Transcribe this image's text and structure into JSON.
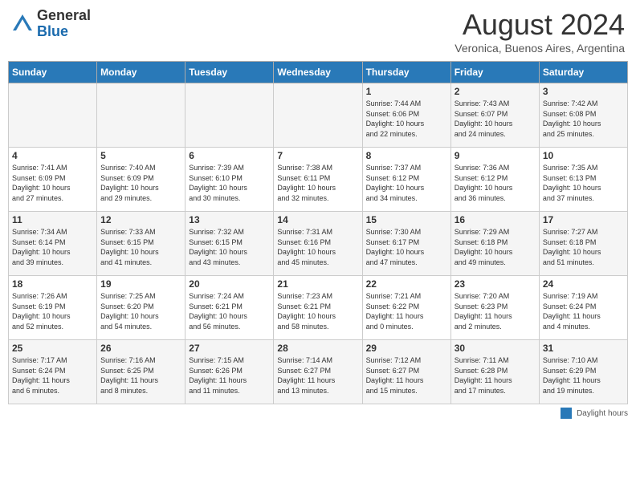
{
  "header": {
    "logo_general": "General",
    "logo_blue": "Blue",
    "month_title": "August 2024",
    "location": "Veronica, Buenos Aires, Argentina"
  },
  "days_of_week": [
    "Sunday",
    "Monday",
    "Tuesday",
    "Wednesday",
    "Thursday",
    "Friday",
    "Saturday"
  ],
  "weeks": [
    [
      {
        "day": "",
        "info": ""
      },
      {
        "day": "",
        "info": ""
      },
      {
        "day": "",
        "info": ""
      },
      {
        "day": "",
        "info": ""
      },
      {
        "day": "1",
        "info": "Sunrise: 7:44 AM\nSunset: 6:06 PM\nDaylight: 10 hours\nand 22 minutes."
      },
      {
        "day": "2",
        "info": "Sunrise: 7:43 AM\nSunset: 6:07 PM\nDaylight: 10 hours\nand 24 minutes."
      },
      {
        "day": "3",
        "info": "Sunrise: 7:42 AM\nSunset: 6:08 PM\nDaylight: 10 hours\nand 25 minutes."
      }
    ],
    [
      {
        "day": "4",
        "info": "Sunrise: 7:41 AM\nSunset: 6:09 PM\nDaylight: 10 hours\nand 27 minutes."
      },
      {
        "day": "5",
        "info": "Sunrise: 7:40 AM\nSunset: 6:09 PM\nDaylight: 10 hours\nand 29 minutes."
      },
      {
        "day": "6",
        "info": "Sunrise: 7:39 AM\nSunset: 6:10 PM\nDaylight: 10 hours\nand 30 minutes."
      },
      {
        "day": "7",
        "info": "Sunrise: 7:38 AM\nSunset: 6:11 PM\nDaylight: 10 hours\nand 32 minutes."
      },
      {
        "day": "8",
        "info": "Sunrise: 7:37 AM\nSunset: 6:12 PM\nDaylight: 10 hours\nand 34 minutes."
      },
      {
        "day": "9",
        "info": "Sunrise: 7:36 AM\nSunset: 6:12 PM\nDaylight: 10 hours\nand 36 minutes."
      },
      {
        "day": "10",
        "info": "Sunrise: 7:35 AM\nSunset: 6:13 PM\nDaylight: 10 hours\nand 37 minutes."
      }
    ],
    [
      {
        "day": "11",
        "info": "Sunrise: 7:34 AM\nSunset: 6:14 PM\nDaylight: 10 hours\nand 39 minutes."
      },
      {
        "day": "12",
        "info": "Sunrise: 7:33 AM\nSunset: 6:15 PM\nDaylight: 10 hours\nand 41 minutes."
      },
      {
        "day": "13",
        "info": "Sunrise: 7:32 AM\nSunset: 6:15 PM\nDaylight: 10 hours\nand 43 minutes."
      },
      {
        "day": "14",
        "info": "Sunrise: 7:31 AM\nSunset: 6:16 PM\nDaylight: 10 hours\nand 45 minutes."
      },
      {
        "day": "15",
        "info": "Sunrise: 7:30 AM\nSunset: 6:17 PM\nDaylight: 10 hours\nand 47 minutes."
      },
      {
        "day": "16",
        "info": "Sunrise: 7:29 AM\nSunset: 6:18 PM\nDaylight: 10 hours\nand 49 minutes."
      },
      {
        "day": "17",
        "info": "Sunrise: 7:27 AM\nSunset: 6:18 PM\nDaylight: 10 hours\nand 51 minutes."
      }
    ],
    [
      {
        "day": "18",
        "info": "Sunrise: 7:26 AM\nSunset: 6:19 PM\nDaylight: 10 hours\nand 52 minutes."
      },
      {
        "day": "19",
        "info": "Sunrise: 7:25 AM\nSunset: 6:20 PM\nDaylight: 10 hours\nand 54 minutes."
      },
      {
        "day": "20",
        "info": "Sunrise: 7:24 AM\nSunset: 6:21 PM\nDaylight: 10 hours\nand 56 minutes."
      },
      {
        "day": "21",
        "info": "Sunrise: 7:23 AM\nSunset: 6:21 PM\nDaylight: 10 hours\nand 58 minutes."
      },
      {
        "day": "22",
        "info": "Sunrise: 7:21 AM\nSunset: 6:22 PM\nDaylight: 11 hours\nand 0 minutes."
      },
      {
        "day": "23",
        "info": "Sunrise: 7:20 AM\nSunset: 6:23 PM\nDaylight: 11 hours\nand 2 minutes."
      },
      {
        "day": "24",
        "info": "Sunrise: 7:19 AM\nSunset: 6:24 PM\nDaylight: 11 hours\nand 4 minutes."
      }
    ],
    [
      {
        "day": "25",
        "info": "Sunrise: 7:17 AM\nSunset: 6:24 PM\nDaylight: 11 hours\nand 6 minutes."
      },
      {
        "day": "26",
        "info": "Sunrise: 7:16 AM\nSunset: 6:25 PM\nDaylight: 11 hours\nand 8 minutes."
      },
      {
        "day": "27",
        "info": "Sunrise: 7:15 AM\nSunset: 6:26 PM\nDaylight: 11 hours\nand 11 minutes."
      },
      {
        "day": "28",
        "info": "Sunrise: 7:14 AM\nSunset: 6:27 PM\nDaylight: 11 hours\nand 13 minutes."
      },
      {
        "day": "29",
        "info": "Sunrise: 7:12 AM\nSunset: 6:27 PM\nDaylight: 11 hours\nand 15 minutes."
      },
      {
        "day": "30",
        "info": "Sunrise: 7:11 AM\nSunset: 6:28 PM\nDaylight: 11 hours\nand 17 minutes."
      },
      {
        "day": "31",
        "info": "Sunrise: 7:10 AM\nSunset: 6:29 PM\nDaylight: 11 hours\nand 19 minutes."
      }
    ]
  ],
  "footer": {
    "legend_label": "Daylight hours"
  }
}
